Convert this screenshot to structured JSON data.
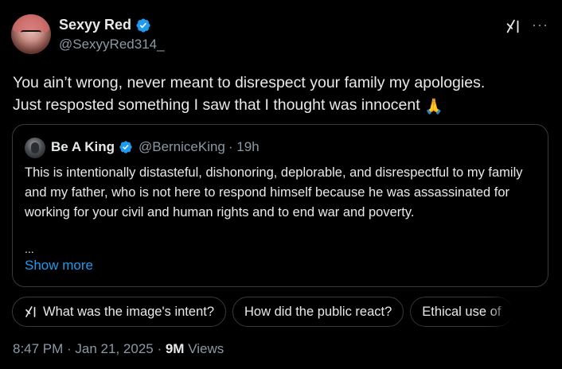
{
  "author": {
    "display_name": "Sexyy Red",
    "handle": "@SexyyRed314_",
    "verified": true
  },
  "tweet_text_line1": "You ain’t wrong, never meant to disrespect your family my apologies.",
  "tweet_text_line2": "Just resposted something I saw that I thought was innocent",
  "tweet_emoji": "🙏",
  "quote": {
    "display_name": "Be A King",
    "handle": "@BerniceKing",
    "time": "· 19h",
    "text": "This is intentionally distasteful, dishonoring, deplorable, and disrespectful to my family and my father, who is not here to respond himself because he was assassinated for working for your civil and human rights and to end war and poverty.",
    "ellipsis": "...",
    "show_more": "Show more"
  },
  "grok_pills": [
    "What was the image's intent?",
    "How did the public react?",
    "Ethical use of "
  ],
  "meta": {
    "time": "8:47 PM",
    "sep1": " · ",
    "date": "Jan 21, 2025",
    "sep2": " · ",
    "views_count": "9M",
    "views_label": " Views"
  },
  "colors": {
    "background": "#000000",
    "text": "#e7e9ea",
    "secondary_text": "#8b98a5",
    "link": "#1d9bf0",
    "border": "#333a40",
    "verified": "#1d9bf0"
  },
  "icons": {
    "verified": "verified-badge-icon",
    "grok": "grok-icon",
    "more": "more-dots-icon"
  }
}
